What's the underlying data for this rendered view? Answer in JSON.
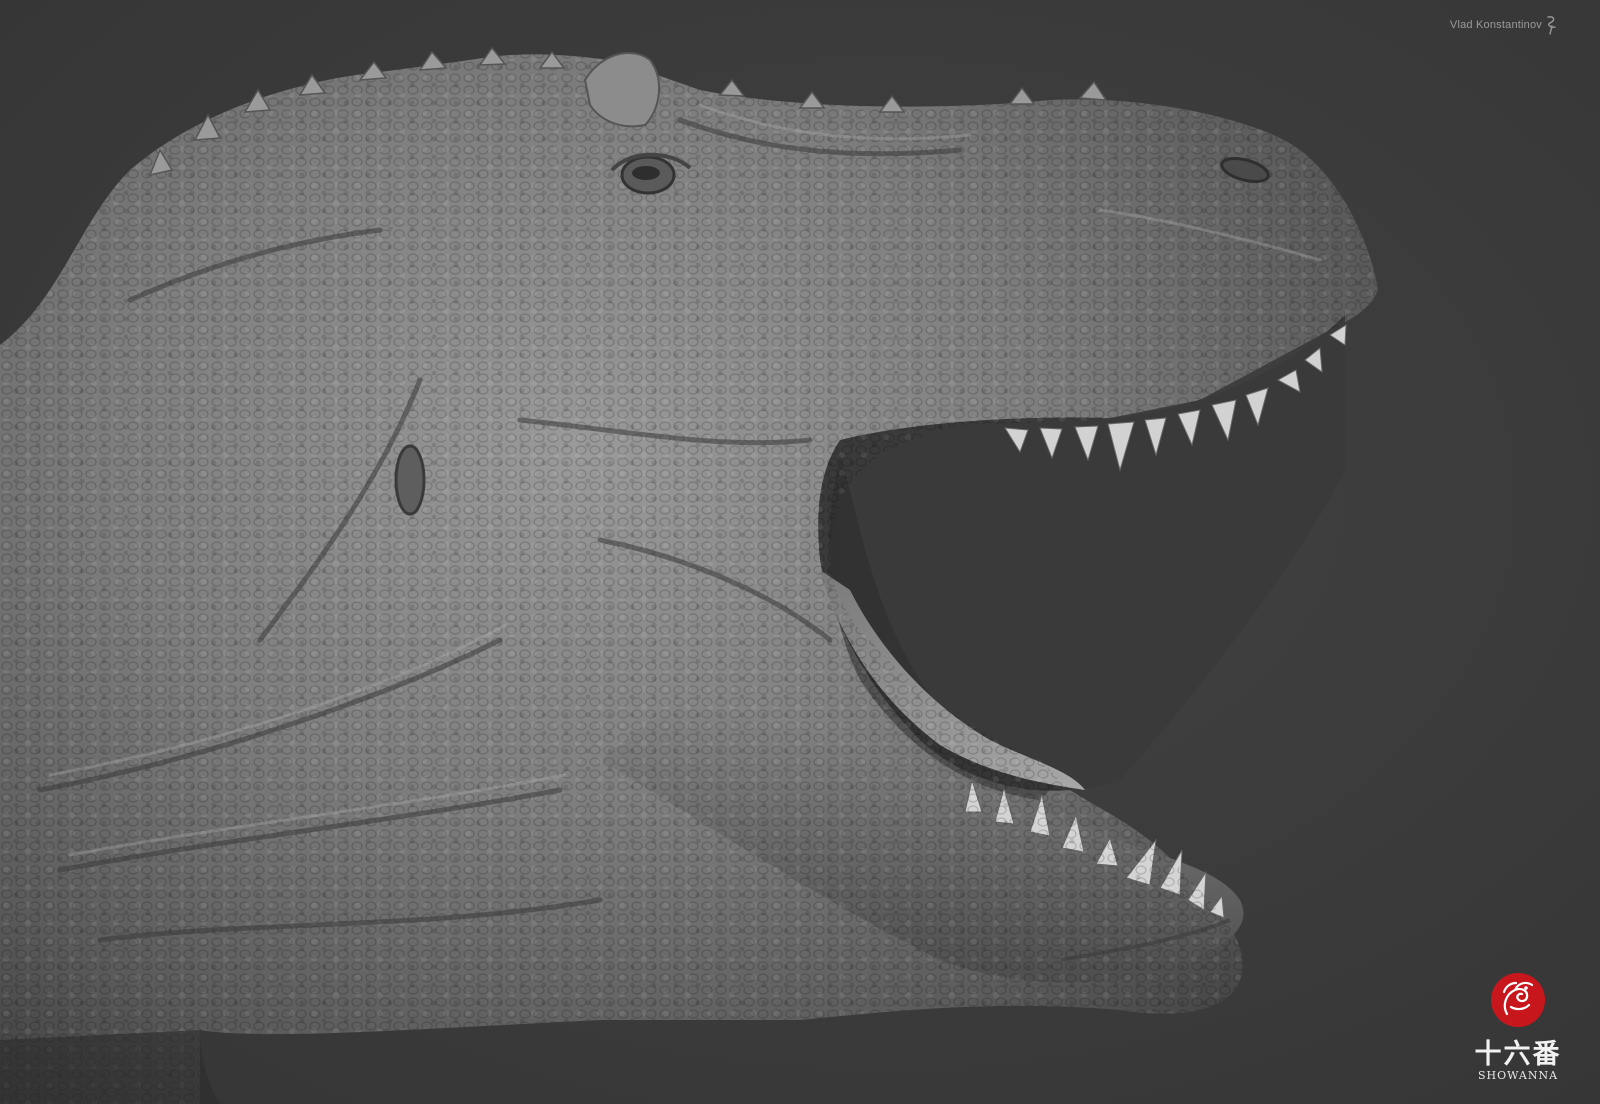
{
  "artwork": {
    "subject_icon": "trex-head-sculpt-icon",
    "background_color": "#3a3a3a",
    "skin_color": "#8a8a8a"
  },
  "credit": {
    "author": "Vlad Konstantinov",
    "mark_icon": "signature-mark-icon"
  },
  "watermark": {
    "seal_icon": "red-dragon-seal-icon",
    "seal_color": "#c8161d",
    "chinese_text": "十六番",
    "latin_text": "SHOWANNA"
  }
}
